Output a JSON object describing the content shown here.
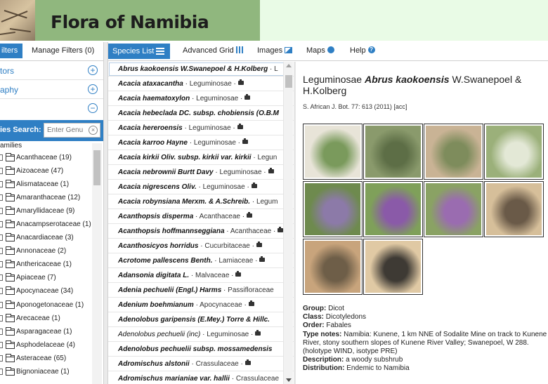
{
  "site": {
    "title": "Flora of Namibia"
  },
  "left_tabs": {
    "filters": "ilters",
    "manage": "Manage Filters (0)"
  },
  "filter_sections": [
    {
      "label": "tors"
    },
    {
      "label": "aphy"
    },
    {
      "label": ""
    }
  ],
  "species_search": {
    "label": "ies Search:",
    "placeholder": "Enter Genu"
  },
  "families_header": "amilies",
  "families": [
    "Acanthaceae (19)",
    "Aizoaceae (47)",
    "Alismataceae (1)",
    "Amaranthaceae (12)",
    "Amaryllidaceae (9)",
    "Anacampserotaceae (1)",
    "Anacardiaceae (3)",
    "Annonaceae (2)",
    "Anthericaceae (1)",
    "Apiaceae (7)",
    "Apocynaceae (34)",
    "Aponogetonaceae (1)",
    "Arecaceae (1)",
    "Asparagaceae (1)",
    "Asphodelaceae (4)",
    "Asteraceae (65)",
    "Bignoniaceae (1)"
  ],
  "top_tabs": [
    {
      "label": "Species List",
      "icon": "list-icon"
    },
    {
      "label": "Advanced Grid",
      "icon": "grid-icon"
    },
    {
      "label": "Images",
      "icon": "image-icon"
    },
    {
      "label": "Maps",
      "icon": "globe-icon"
    },
    {
      "label": "Help",
      "icon": "help-icon"
    }
  ],
  "species": [
    {
      "name": "Abrus kaokoensis W.Swanepoel & H.Kolberg",
      "family": "L",
      "bold": true,
      "photo": false
    },
    {
      "name": "Acacia ataxacantha",
      "family": "Leguminosae",
      "bold": true,
      "photo": true
    },
    {
      "name": "Acacia haematoxylon",
      "family": "Leguminosae",
      "bold": true,
      "photo": true
    },
    {
      "name": "Acacia hebeclada DC. subsp. chobiensis (O.B.M",
      "family": "",
      "bold": true,
      "photo": false
    },
    {
      "name": "Acacia hereroensis",
      "family": "Leguminosae",
      "bold": true,
      "photo": true
    },
    {
      "name": "Acacia karroo Hayne",
      "family": "Leguminosae",
      "bold": true,
      "photo": true
    },
    {
      "name": "Acacia kirkii Oliv. subsp. kirkii var. kirkii",
      "family": "Legun",
      "bold": true,
      "photo": false
    },
    {
      "name": "Acacia nebrownii Burtt Davy",
      "family": "Leguminosae",
      "bold": true,
      "photo": true
    },
    {
      "name": "Acacia nigrescens Oliv.",
      "family": "Leguminosae",
      "bold": true,
      "photo": true
    },
    {
      "name": "Acacia robynsiana Merxm. & A.Schreib.",
      "family": "Legum",
      "bold": true,
      "photo": false
    },
    {
      "name": "Acanthopsis disperma",
      "family": "Acanthaceae",
      "bold": true,
      "photo": true
    },
    {
      "name": "Acanthopsis hoffmannseggiana",
      "family": "Acanthaceae",
      "bold": true,
      "photo": true
    },
    {
      "name": "Acanthosicyos horridus",
      "family": "Cucurbitaceae",
      "bold": true,
      "photo": true
    },
    {
      "name": "Acrotome pallescens Benth.",
      "family": "Lamiaceae",
      "bold": true,
      "photo": true
    },
    {
      "name": "Adansonia digitata L.",
      "family": "Malvaceae",
      "bold": true,
      "photo": true
    },
    {
      "name": "Adenia pechuelii (Engl.) Harms",
      "family": "Passifloraceae",
      "bold": true,
      "photo": false
    },
    {
      "name": "Adenium boehmianum",
      "family": "Apocynaceae",
      "bold": true,
      "photo": true
    },
    {
      "name": "Adenolobus garipensis (E.Mey.) Torre & Hillc.",
      "family": "",
      "bold": true,
      "photo": false
    },
    {
      "name": "Adenolobus pechuelii (inc)",
      "family": "Leguminosae",
      "bold": false,
      "photo": true
    },
    {
      "name": "Adenolobus pechuelii subsp. mossamedensis",
      "family": "",
      "bold": true,
      "photo": false
    },
    {
      "name": "Adromischus alstonii",
      "family": "Crassulaceae",
      "bold": true,
      "photo": true
    },
    {
      "name": "Adromischus marianiae var. hallii",
      "family": "Crassulaceae",
      "bold": true,
      "photo": false
    }
  ],
  "detail": {
    "family": "Leguminosae",
    "species": "Abrus kaokoensis",
    "authority": "W.Swanepoel & H.Kolberg",
    "reference": "S. African J. Bot. 77: 613 (2011) [acc]",
    "facts": [
      {
        "label": "Group:",
        "value": "Dicot"
      },
      {
        "label": "Class:",
        "value": "Dicotyledons"
      },
      {
        "label": "Order:",
        "value": "Fabales"
      },
      {
        "label": "Type notes:",
        "value": "Namibia: Kunene, 1 km NNE of Sodalite Mine on track to Kunene River, stony southern slopes of Kunene River Valley; Swanepoel, W 288. (holotype WIND, isotype PRE)"
      },
      {
        "label": "Description:",
        "value": "a woody subshrub"
      },
      {
        "label": "Distribution:",
        "value": "Endemic to Namibia"
      }
    ]
  },
  "thumb_colors": [
    [
      "#e8e4d8",
      "#7a9a5c"
    ],
    [
      "#8a9a6c",
      "#5d6e46"
    ],
    [
      "#c9b395",
      "#7e8c5c"
    ],
    [
      "#9bb07a",
      "#e3e8d6"
    ],
    [
      "#6e8a4e",
      "#8c7aa8"
    ],
    [
      "#7fa05a",
      "#8a5aa8"
    ],
    [
      "#8aa264",
      "#9a6cb0"
    ],
    [
      "#d6bf9a",
      "#6a5a48"
    ],
    [
      "#c8a47c",
      "#6e5e48"
    ],
    [
      "#e0c9a4",
      "#3e3a34"
    ]
  ]
}
